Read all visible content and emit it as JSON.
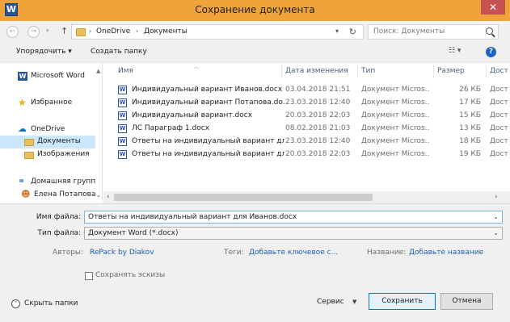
{
  "window": {
    "title": "Сохранение документа",
    "app_icon": "W",
    "close_glyph": "✕"
  },
  "address": {
    "crumbs": [
      "OneDrive",
      "Документы"
    ],
    "search_placeholder": "Поиск: Документы"
  },
  "toolbar": {
    "organize": "Упорядочить ▾",
    "new_folder": "Создать папку",
    "view": "☷ ▾",
    "help": "?"
  },
  "sidebar": {
    "items": [
      {
        "label": "Microsoft Word",
        "icon": "word-icon"
      },
      {
        "label": "Избранное",
        "icon": "star-icon"
      },
      {
        "label": "OneDrive",
        "icon": "cloud-icon"
      },
      {
        "label": "Документы",
        "icon": "folder-icon",
        "selected": true
      },
      {
        "label": "Изображения",
        "icon": "folder-icon"
      },
      {
        "label": "Домашняя группа",
        "icon": "homegroup-icon"
      },
      {
        "label": "Елена Потапова",
        "icon": "user-icon"
      }
    ]
  },
  "files": {
    "columns": [
      "Имя",
      "Дата изменения",
      "Тип",
      "Размер",
      "Дост"
    ],
    "rows": [
      {
        "name": "Индивидуальный вариант Иванов.docx",
        "date": "03.04.2018 21:51",
        "type": "Документ Micros...",
        "size": "26 КБ",
        "extra": "Дост"
      },
      {
        "name": "Индивидуальный вариант Потапова.do...",
        "date": "23.03.2018 12:40",
        "type": "Документ Micros...",
        "size": "17 КБ",
        "extra": "Дост"
      },
      {
        "name": "Индивидуальный вариант.docx",
        "date": "20.03.2018 22:03",
        "type": "Документ Micros...",
        "size": "15 КБ",
        "extra": "Дост"
      },
      {
        "name": "ЛС Параграф 1.docx",
        "date": "08.02.2018 21:03",
        "type": "Документ Micros...",
        "size": "13 КБ",
        "extra": "Дост"
      },
      {
        "name": "Ответы на индивидуальный вариант дл...",
        "date": "23.03.2018 12:40",
        "type": "Документ Micros...",
        "size": "18 КБ",
        "extra": "Дост"
      },
      {
        "name": "Ответы на индивидуальный вариант дл...",
        "date": "20.03.2018 22:03",
        "type": "Документ Micros...",
        "size": "19 КБ",
        "extra": "Дост"
      }
    ]
  },
  "form": {
    "filename_label": "Имя файла:",
    "filename_value": "Ответы на индивидуальный вариант для Иванов.docx",
    "filetype_label": "Тип файла:",
    "filetype_value": "Документ Word (*.docx)",
    "authors_label": "Авторы:",
    "authors_value": "RePack by Diakov",
    "tags_label": "Теги:",
    "tags_value": "Добавьте ключевое с...",
    "title_label": "Название:",
    "title_value": "Добавьте название",
    "thumbnails_label": "Сохранять эскизы",
    "hide_folders": "Скрыть папки",
    "service": "Сервис",
    "save": "Сохранить",
    "cancel": "Отмена"
  }
}
